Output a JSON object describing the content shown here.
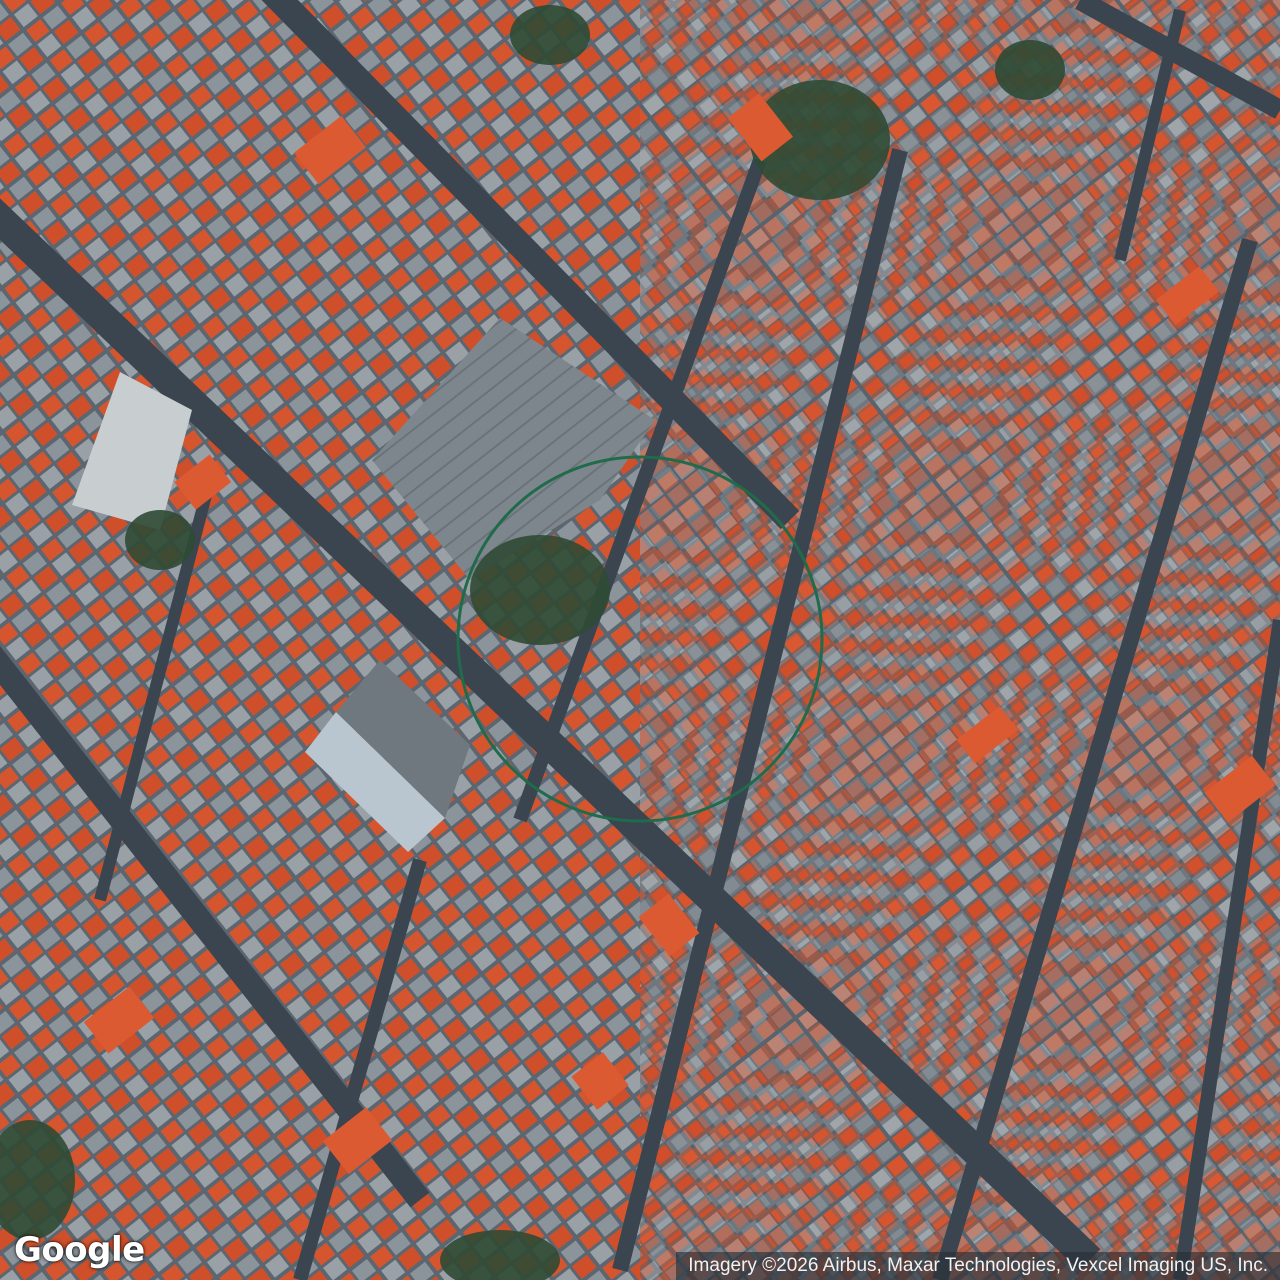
{
  "map": {
    "type": "satellite",
    "logo_text": "Google",
    "attribution": "Imagery ©2026 Airbus, Maxar Technologies, Vexcel Imaging US, Inc.",
    "marker": {
      "shape": "circle",
      "stroke_color": "#1f6b4a"
    },
    "colors": {
      "roof_red": "#d9532e",
      "roof_gray": "#7d858c",
      "street": "#3c4650",
      "vegetation": "#2e4a33"
    }
  }
}
